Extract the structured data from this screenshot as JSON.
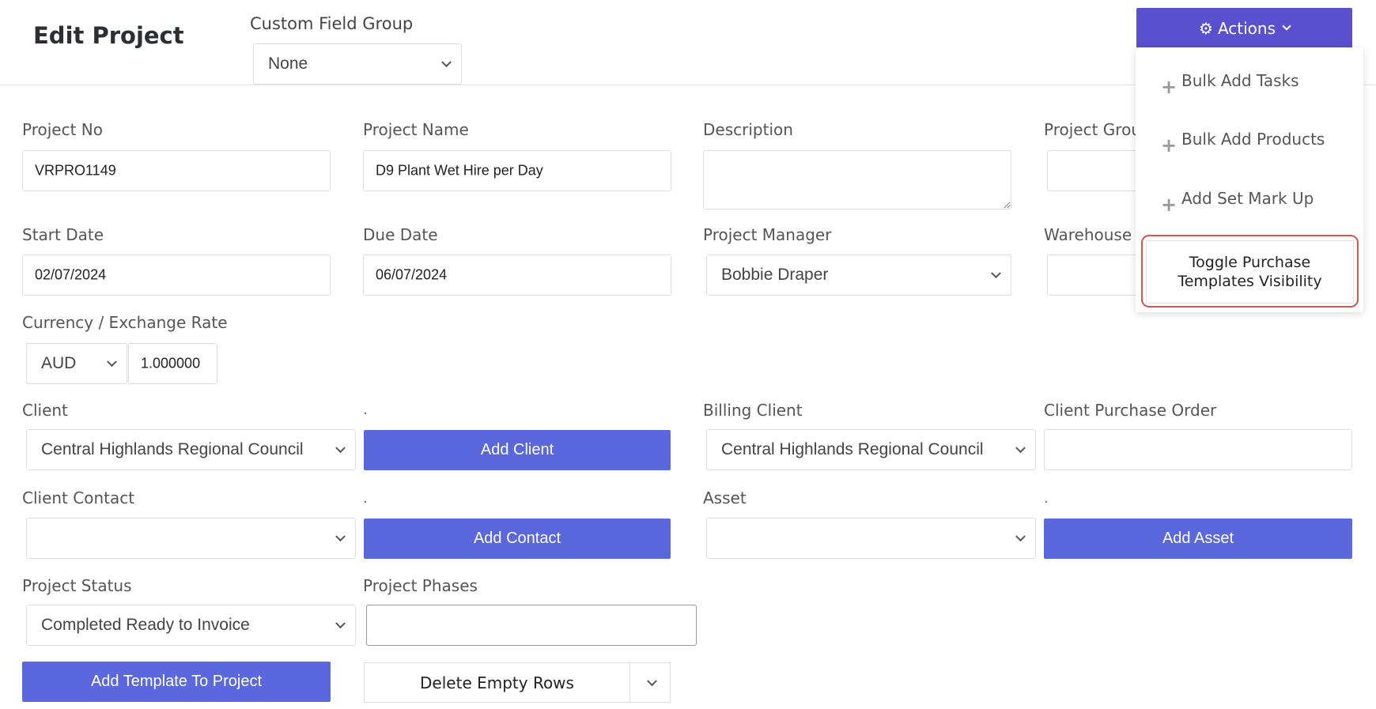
{
  "header": {
    "title": "Edit Project",
    "custom_field_group": {
      "label": "Custom Field Group",
      "value": "None"
    },
    "actions": {
      "label": "Actions",
      "menu": [
        "Bulk Add Tasks",
        "Bulk Add Products",
        "Add Set Mark Up",
        "Toggle Purchase Templates Visibility"
      ]
    }
  },
  "form": {
    "project_no": {
      "label": "Project No",
      "value": "VRPRO1149"
    },
    "project_name": {
      "label": "Project Name",
      "value": "D9 Plant Wet Hire per Day"
    },
    "description": {
      "label": "Description",
      "value": ""
    },
    "project_group": {
      "label": "Project Grou"
    },
    "start_date": {
      "label": "Start Date",
      "value": "02/07/2024"
    },
    "due_date": {
      "label": "Due Date",
      "value": "06/07/2024"
    },
    "project_manager": {
      "label": "Project Manager",
      "value": "Bobbie Draper"
    },
    "warehouse": {
      "label": "Warehouse"
    },
    "currency": {
      "label": "Currency / Exchange Rate",
      "currency": "AUD",
      "rate": "1.000000"
    },
    "client": {
      "label": "Client",
      "value": "Central Highlands Regional Council"
    },
    "add_client": "Add Client",
    "billing_client": {
      "label": "Billing Client",
      "value": "Central Highlands Regional Council"
    },
    "client_po": {
      "label": "Client Purchase Order",
      "value": ""
    },
    "client_contact": {
      "label": "Client Contact",
      "value": ""
    },
    "add_contact": "Add Contact",
    "asset": {
      "label": "Asset",
      "value": ""
    },
    "add_asset": "Add Asset",
    "project_status": {
      "label": "Project Status",
      "value": "Completed Ready to Invoice"
    },
    "project_phases": {
      "label": "Project Phases",
      "value": ""
    },
    "add_template": "Add Template To Project",
    "delete_empty_rows": "Delete Empty Rows",
    "dot": "."
  },
  "colors": {
    "primary": "#5a67dd",
    "actions": "#5a4fcf",
    "highlight": "#d9534f"
  },
  "icons": {
    "actions": "gear-icon",
    "menu_items": "plus-icon"
  }
}
